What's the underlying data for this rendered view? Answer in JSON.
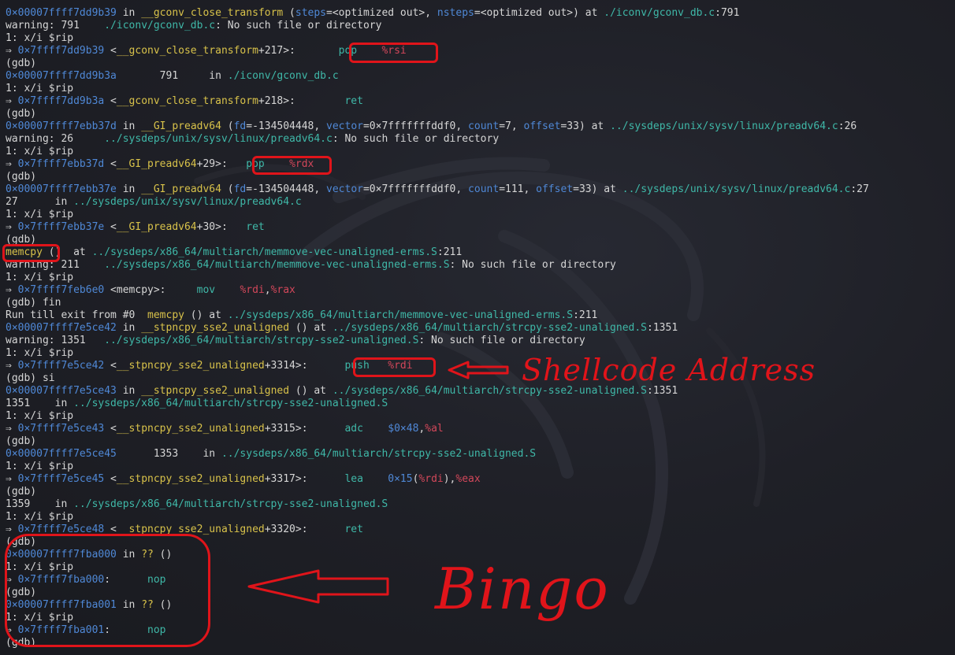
{
  "colors": {
    "background": "#1f2027",
    "default_text": "#d6d6d6",
    "address": "#4f88d6",
    "function": "#d8c24a",
    "path": "#3fb8a8",
    "register": "#d2475a",
    "annotation": "#e0141a"
  },
  "terminal": {
    "lines": [
      [
        [
          "addr",
          "0×00007ffff7dd9b39"
        ],
        [
          "default",
          " in "
        ],
        [
          "func",
          "__gconv_close_transform"
        ],
        [
          "default",
          " ("
        ],
        [
          "param",
          "steps"
        ],
        [
          "default",
          "=<optimized out>, "
        ],
        [
          "param",
          "nsteps"
        ],
        [
          "default",
          "=<optimized out>) at "
        ],
        [
          "path",
          "./iconv/gconv_db.c"
        ],
        [
          "default",
          ":791"
        ]
      ],
      [
        [
          "default",
          "warning: 791    "
        ],
        [
          "path",
          "./iconv/gconv_db.c"
        ],
        [
          "default",
          ": No such file or directory"
        ]
      ],
      [
        [
          "default",
          "1: x/i $rip"
        ]
      ],
      [
        [
          "default",
          "⇒ "
        ],
        [
          "addr",
          "0×7ffff7dd9b39"
        ],
        [
          "default",
          " <"
        ],
        [
          "func",
          "__gconv_close_transform"
        ],
        [
          "default",
          "+217>:       "
        ],
        [
          "mnem",
          "pop"
        ],
        [
          "default",
          "    "
        ],
        [
          "reg",
          "%rsi"
        ]
      ],
      [
        [
          "default",
          "(gdb)"
        ]
      ],
      [
        [
          "addr",
          "0×00007ffff7dd9b3a"
        ],
        [
          "default",
          "       791     in "
        ],
        [
          "path",
          "./iconv/gconv_db.c"
        ]
      ],
      [
        [
          "default",
          "1: x/i $rip"
        ]
      ],
      [
        [
          "default",
          "⇒ "
        ],
        [
          "addr",
          "0×7ffff7dd9b3a"
        ],
        [
          "default",
          " <"
        ],
        [
          "func",
          "__gconv_close_transform"
        ],
        [
          "default",
          "+218>:        "
        ],
        [
          "mnem",
          "ret"
        ]
      ],
      [
        [
          "default",
          "(gdb)"
        ]
      ],
      [
        [
          "addr",
          "0×00007ffff7ebb37d"
        ],
        [
          "default",
          " in "
        ],
        [
          "func",
          "__GI_preadv64"
        ],
        [
          "default",
          " ("
        ],
        [
          "param",
          "fd"
        ],
        [
          "default",
          "=-134504448, "
        ],
        [
          "param",
          "vector"
        ],
        [
          "default",
          "=0×7fffffffddf0, "
        ],
        [
          "param",
          "count"
        ],
        [
          "default",
          "=7, "
        ],
        [
          "param",
          "offset"
        ],
        [
          "default",
          "=33) at "
        ],
        [
          "path",
          "../sysdeps/unix/sysv/linux/preadv64.c"
        ],
        [
          "default",
          ":26"
        ]
      ],
      [
        [
          "default",
          "warning: 26     "
        ],
        [
          "path",
          "../sysdeps/unix/sysv/linux/preadv64.c"
        ],
        [
          "default",
          ": No such file or directory"
        ]
      ],
      [
        [
          "default",
          "1: x/i $rip"
        ]
      ],
      [
        [
          "default",
          "⇒ "
        ],
        [
          "addr",
          "0×7ffff7ebb37d"
        ],
        [
          "default",
          " <"
        ],
        [
          "func",
          "__GI_preadv64"
        ],
        [
          "default",
          "+29>:   "
        ],
        [
          "mnem",
          "pop"
        ],
        [
          "default",
          "    "
        ],
        [
          "reg",
          "%rdx"
        ]
      ],
      [
        [
          "default",
          "(gdb)"
        ]
      ],
      [
        [
          "addr",
          "0×00007ffff7ebb37e"
        ],
        [
          "default",
          " in "
        ],
        [
          "func",
          "__GI_preadv64"
        ],
        [
          "default",
          " ("
        ],
        [
          "param",
          "fd"
        ],
        [
          "default",
          "=-134504448, "
        ],
        [
          "param",
          "vector"
        ],
        [
          "default",
          "=0×7fffffffddf0, "
        ],
        [
          "param",
          "count"
        ],
        [
          "default",
          "=111, "
        ],
        [
          "param",
          "offset"
        ],
        [
          "default",
          "=33) at "
        ],
        [
          "path",
          "../sysdeps/unix/sysv/linux/preadv64.c"
        ],
        [
          "default",
          ":27"
        ]
      ],
      [
        [
          "default",
          "27      in "
        ],
        [
          "path",
          "../sysdeps/unix/sysv/linux/preadv64.c"
        ]
      ],
      [
        [
          "default",
          "1: x/i $rip"
        ]
      ],
      [
        [
          "default",
          "⇒ "
        ],
        [
          "addr",
          "0×7ffff7ebb37e"
        ],
        [
          "default",
          " <"
        ],
        [
          "func",
          "__GI_preadv64"
        ],
        [
          "default",
          "+30>:   "
        ],
        [
          "mnem",
          "ret"
        ]
      ],
      [
        [
          "default",
          "(gdb)"
        ]
      ],
      [
        [
          "func",
          "memcpy"
        ],
        [
          "default",
          " ()  at "
        ],
        [
          "path",
          "../sysdeps/x86_64/multiarch/memmove-vec-unaligned-erms.S"
        ],
        [
          "default",
          ":211"
        ]
      ],
      [
        [
          "default",
          "warning: 211    "
        ],
        [
          "path",
          "../sysdeps/x86_64/multiarch/memmove-vec-unaligned-erms.S"
        ],
        [
          "default",
          ": No such file or directory"
        ]
      ],
      [
        [
          "default",
          "1: x/i $rip"
        ]
      ],
      [
        [
          "default",
          "⇒ "
        ],
        [
          "addr",
          "0×7ffff7feb6e0"
        ],
        [
          "default",
          " <memcpy>:     "
        ],
        [
          "mnem",
          "mov"
        ],
        [
          "default",
          "    "
        ],
        [
          "reg",
          "%rdi"
        ],
        [
          "default",
          ","
        ],
        [
          "reg",
          "%rax"
        ]
      ],
      [
        [
          "default",
          "(gdb) fin"
        ]
      ],
      [
        [
          "default",
          "Run till exit from #0  "
        ],
        [
          "func",
          "memcpy"
        ],
        [
          "default",
          " () at "
        ],
        [
          "path",
          "../sysdeps/x86_64/multiarch/memmove-vec-unaligned-erms.S"
        ],
        [
          "default",
          ":211"
        ]
      ],
      [
        [
          "addr",
          "0×00007ffff7e5ce42"
        ],
        [
          "default",
          " in "
        ],
        [
          "func",
          "__stpncpy_sse2_unaligned"
        ],
        [
          "default",
          " () at "
        ],
        [
          "path",
          "../sysdeps/x86_64/multiarch/strcpy-sse2-unaligned.S"
        ],
        [
          "default",
          ":1351"
        ]
      ],
      [
        [
          "default",
          "warning: 1351   "
        ],
        [
          "path",
          "../sysdeps/x86_64/multiarch/strcpy-sse2-unaligned.S"
        ],
        [
          "default",
          ": No such file or directory"
        ]
      ],
      [
        [
          "default",
          "1: x/i $rip"
        ]
      ],
      [
        [
          "default",
          "⇒ "
        ],
        [
          "addr",
          "0×7ffff7e5ce42"
        ],
        [
          "default",
          " <"
        ],
        [
          "func",
          "__stpncpy_sse2_unaligned"
        ],
        [
          "default",
          "+3314>:      "
        ],
        [
          "mnem",
          "push"
        ],
        [
          "default",
          "   "
        ],
        [
          "reg",
          "%rdi"
        ]
      ],
      [
        [
          "default",
          "(gdb) si"
        ]
      ],
      [
        [
          "addr",
          "0×00007ffff7e5ce43"
        ],
        [
          "default",
          " in "
        ],
        [
          "func",
          "__stpncpy_sse2_unaligned"
        ],
        [
          "default",
          " () at "
        ],
        [
          "path",
          "../sysdeps/x86_64/multiarch/strcpy-sse2-unaligned.S"
        ],
        [
          "default",
          ":1351"
        ]
      ],
      [
        [
          "default",
          "1351    in "
        ],
        [
          "path",
          "../sysdeps/x86_64/multiarch/strcpy-sse2-unaligned.S"
        ]
      ],
      [
        [
          "default",
          "1: x/i $rip"
        ]
      ],
      [
        [
          "default",
          "⇒ "
        ],
        [
          "addr",
          "0×7ffff7e5ce43"
        ],
        [
          "default",
          " <"
        ],
        [
          "func",
          "__stpncpy_sse2_unaligned"
        ],
        [
          "default",
          "+3315>:      "
        ],
        [
          "mnem",
          "adc"
        ],
        [
          "default",
          "    "
        ],
        [
          "num",
          "$0×48"
        ],
        [
          "default",
          ","
        ],
        [
          "reg",
          "%al"
        ]
      ],
      [
        [
          "default",
          "(gdb)"
        ]
      ],
      [
        [
          "addr",
          "0×00007ffff7e5ce45"
        ],
        [
          "default",
          "      1353    in "
        ],
        [
          "path",
          "../sysdeps/x86_64/multiarch/strcpy-sse2-unaligned.S"
        ]
      ],
      [
        [
          "default",
          "1: x/i $rip"
        ]
      ],
      [
        [
          "default",
          "⇒ "
        ],
        [
          "addr",
          "0×7ffff7e5ce45"
        ],
        [
          "default",
          " <"
        ],
        [
          "func",
          "__stpncpy_sse2_unaligned"
        ],
        [
          "default",
          "+3317>:      "
        ],
        [
          "mnem",
          "lea"
        ],
        [
          "default",
          "    "
        ],
        [
          "num",
          "0×15"
        ],
        [
          "default",
          "("
        ],
        [
          "reg",
          "%rdi"
        ],
        [
          "default",
          "),"
        ],
        [
          "reg",
          "%eax"
        ]
      ],
      [
        [
          "default",
          "(gdb)"
        ]
      ],
      [
        [
          "default",
          "1359    in "
        ],
        [
          "path",
          "../sysdeps/x86_64/multiarch/strcpy-sse2-unaligned.S"
        ]
      ],
      [
        [
          "default",
          "1: x/i $rip"
        ]
      ],
      [
        [
          "default",
          "⇒ "
        ],
        [
          "addr",
          "0×7ffff7e5ce48"
        ],
        [
          "default",
          " <"
        ],
        [
          "func",
          "__stpncpy_sse2_unaligned"
        ],
        [
          "default",
          "+3320>:      "
        ],
        [
          "mnem",
          "ret"
        ]
      ],
      [
        [
          "default",
          "(gdb)"
        ]
      ],
      [
        [
          "addr",
          "0×00007ffff7fba000"
        ],
        [
          "default",
          " in "
        ],
        [
          "q",
          "??"
        ],
        [
          "default",
          " ()"
        ]
      ],
      [
        [
          "default",
          "1: x/i $rip"
        ]
      ],
      [
        [
          "default",
          "⇒ "
        ],
        [
          "addr",
          "0×7ffff7fba000"
        ],
        [
          "default",
          ":      "
        ],
        [
          "mnem",
          "nop"
        ]
      ],
      [
        [
          "default",
          "(gdb)"
        ]
      ],
      [
        [
          "addr",
          "0×00007ffff7fba001"
        ],
        [
          "default",
          " in "
        ],
        [
          "q",
          "??"
        ],
        [
          "default",
          " ()"
        ]
      ],
      [
        [
          "default",
          "1: x/i $rip"
        ]
      ],
      [
        [
          "default",
          "⇒ "
        ],
        [
          "addr",
          "0×7ffff7fba001"
        ],
        [
          "default",
          ":      "
        ],
        [
          "mnem",
          "nop"
        ]
      ],
      [
        [
          "default",
          "(gdb)"
        ]
      ]
    ]
  },
  "annotations": {
    "shellcode_label": "Shellcode Address",
    "bingo_label": "Bingo"
  }
}
